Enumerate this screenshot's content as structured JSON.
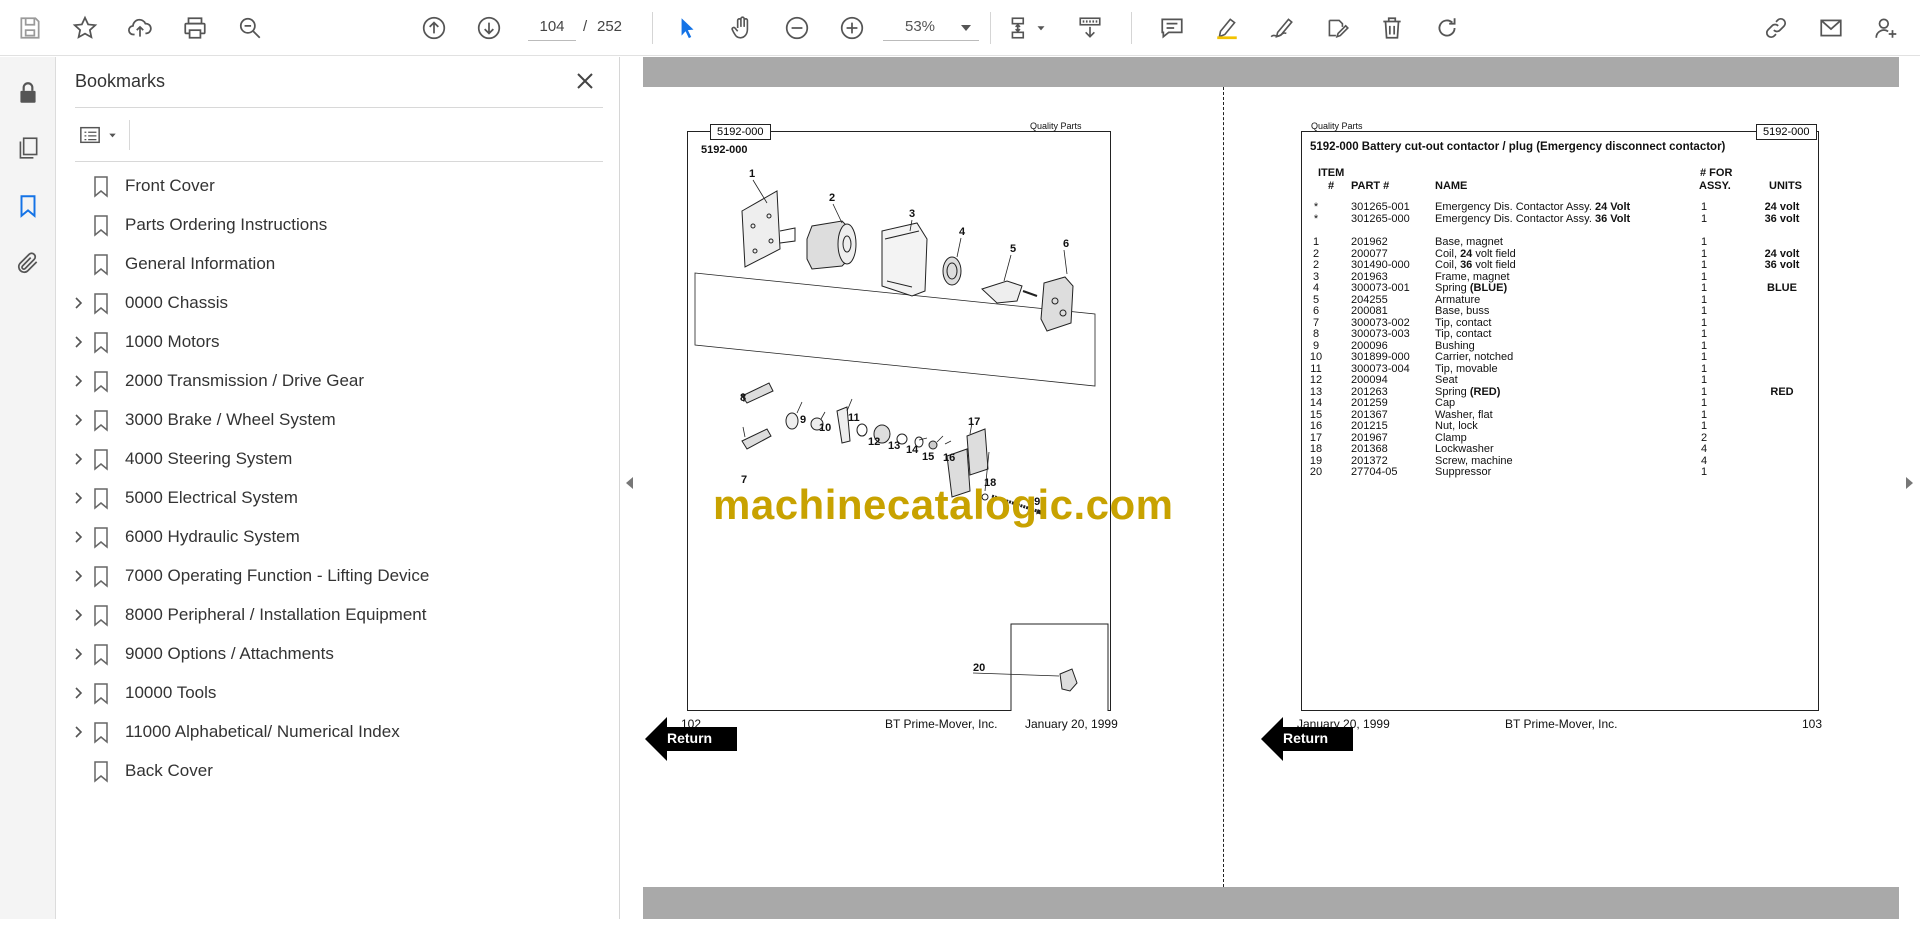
{
  "toolbar": {
    "current_page": "104",
    "page_separator": "/",
    "total_pages": "252",
    "zoom": "53%"
  },
  "bookmarks": {
    "title": "Bookmarks",
    "items": [
      {
        "label": "Front Cover",
        "expandable": false
      },
      {
        "label": "Parts Ordering Instructions",
        "expandable": false
      },
      {
        "label": "General Information",
        "expandable": false
      },
      {
        "label": "0000 Chassis",
        "expandable": true
      },
      {
        "label": "1000 Motors",
        "expandable": true
      },
      {
        "label": "2000 Transmission / Drive Gear",
        "expandable": true
      },
      {
        "label": "3000 Brake / Wheel System",
        "expandable": true
      },
      {
        "label": "4000 Steering System",
        "expandable": true
      },
      {
        "label": "5000 Electrical System",
        "expandable": true
      },
      {
        "label": "6000 Hydraulic System",
        "expandable": true
      },
      {
        "label": "7000 Operating Function - Lifting Device",
        "expandable": true
      },
      {
        "label": "8000 Peripheral / Installation Equipment",
        "expandable": true
      },
      {
        "label": "9000 Options / Attachments",
        "expandable": true
      },
      {
        "label": "10000 Tools",
        "expandable": true
      },
      {
        "label": "11000 Alphabetical/ Numerical Index",
        "expandable": true
      },
      {
        "label": "Back Cover",
        "expandable": false
      }
    ]
  },
  "left_page": {
    "tag": "5192-000",
    "quality": "Quality Parts",
    "code": "5192-000",
    "callouts": [
      "1",
      "2",
      "3",
      "4",
      "5",
      "6",
      "7",
      "8",
      "9",
      "10",
      "11",
      "12",
      "13",
      "14",
      "15",
      "16",
      "17",
      "18",
      "19",
      "20"
    ],
    "footer_page": "102",
    "footer_company": "BT Prime-Mover, Inc.",
    "footer_date": "January 20, 1999",
    "return_label": "Return"
  },
  "watermark": "machinecatalogic.com",
  "right_page": {
    "tag": "5192-000",
    "quality": "Quality Parts",
    "title": "5192-000 Battery cut-out contactor / plug (Emergency disconnect contactor)",
    "headers": {
      "item_top": "ITEM",
      "item": "#",
      "part": "PART #",
      "name": "NAME",
      "qty_top": "# FOR",
      "qty": "ASSY.",
      "units": "UNITS"
    },
    "assemblies": [
      {
        "item": "*",
        "part": "301265-001",
        "name": "Emergency Dis. Contactor Assy. ",
        "name_bold": "24 Volt",
        "qty": "1",
        "units": "24 volt"
      },
      {
        "item": "*",
        "part": "301265-000",
        "name": "Emergency Dis. Contactor Assy. ",
        "name_bold": "36 Volt",
        "qty": "1",
        "units": "36 volt"
      }
    ],
    "parts": [
      {
        "item": "1",
        "part": "201962",
        "name": "Base, magnet",
        "name_bold": "",
        "name_after": "",
        "qty": "1",
        "units": ""
      },
      {
        "item": "2",
        "part": "200077",
        "name": "Coil, ",
        "name_bold": "24",
        "name_after": " volt field",
        "qty": "1",
        "units": "24 volt"
      },
      {
        "item": "2",
        "part": "301490-000",
        "name": "Coil, ",
        "name_bold": "36",
        "name_after": " volt field",
        "qty": "1",
        "units": "36 volt"
      },
      {
        "item": "3",
        "part": "201963",
        "name": "Frame, magnet",
        "name_bold": "",
        "name_after": "",
        "qty": "1",
        "units": ""
      },
      {
        "item": "4",
        "part": "300073-001",
        "name": "Spring ",
        "name_bold": "(BLUE)",
        "name_after": "",
        "qty": "1",
        "units": "BLUE"
      },
      {
        "item": "5",
        "part": "204255",
        "name": "Armature",
        "name_bold": "",
        "name_after": "",
        "qty": "1",
        "units": ""
      },
      {
        "item": "6",
        "part": "200081",
        "name": "Base, buss",
        "name_bold": "",
        "name_after": "",
        "qty": "1",
        "units": ""
      },
      {
        "item": "7",
        "part": "300073-002",
        "name": "Tip, contact",
        "name_bold": "",
        "name_after": "",
        "qty": "1",
        "units": ""
      },
      {
        "item": "8",
        "part": "300073-003",
        "name": "Tip, contact",
        "name_bold": "",
        "name_after": "",
        "qty": "1",
        "units": ""
      },
      {
        "item": "9",
        "part": "200096",
        "name": "Bushing",
        "name_bold": "",
        "name_after": "",
        "qty": "1",
        "units": ""
      },
      {
        "item": "10",
        "part": "301899-000",
        "name": "Carrier, notched",
        "name_bold": "",
        "name_after": "",
        "qty": "1",
        "units": ""
      },
      {
        "item": "11",
        "part": "300073-004",
        "name": "Tip, movable",
        "name_bold": "",
        "name_after": "",
        "qty": "1",
        "units": ""
      },
      {
        "item": "12",
        "part": "200094",
        "name": "Seat",
        "name_bold": "",
        "name_after": "",
        "qty": "1",
        "units": ""
      },
      {
        "item": "13",
        "part": "201263",
        "name": "Spring ",
        "name_bold": "(RED)",
        "name_after": "",
        "qty": "1",
        "units": "RED"
      },
      {
        "item": "14",
        "part": "201259",
        "name": "Cap",
        "name_bold": "",
        "name_after": "",
        "qty": "1",
        "units": ""
      },
      {
        "item": "15",
        "part": "201367",
        "name": "Washer, flat",
        "name_bold": "",
        "name_after": "",
        "qty": "1",
        "units": ""
      },
      {
        "item": "16",
        "part": "201215",
        "name": "Nut, lock",
        "name_bold": "",
        "name_after": "",
        "qty": "1",
        "units": ""
      },
      {
        "item": "17",
        "part": "201967",
        "name": "Clamp",
        "name_bold": "",
        "name_after": "",
        "qty": "2",
        "units": ""
      },
      {
        "item": "18",
        "part": "201368",
        "name": "Lockwasher",
        "name_bold": "",
        "name_after": "",
        "qty": "4",
        "units": ""
      },
      {
        "item": "19",
        "part": "201372",
        "name": "Screw, machine",
        "name_bold": "",
        "name_after": "",
        "qty": "4",
        "units": ""
      },
      {
        "item": "20",
        "part": "27704-05",
        "name": "Suppressor",
        "name_bold": "",
        "name_after": "",
        "qty": "1",
        "units": ""
      }
    ],
    "footer_date": "January 20, 1999",
    "footer_company": "BT Prime-Mover, Inc.",
    "footer_page": "103",
    "return_label": "Return"
  },
  "colors": {
    "accent": "#1473e6",
    "watermark": "#c8a200",
    "band": "#a9a9a9"
  }
}
